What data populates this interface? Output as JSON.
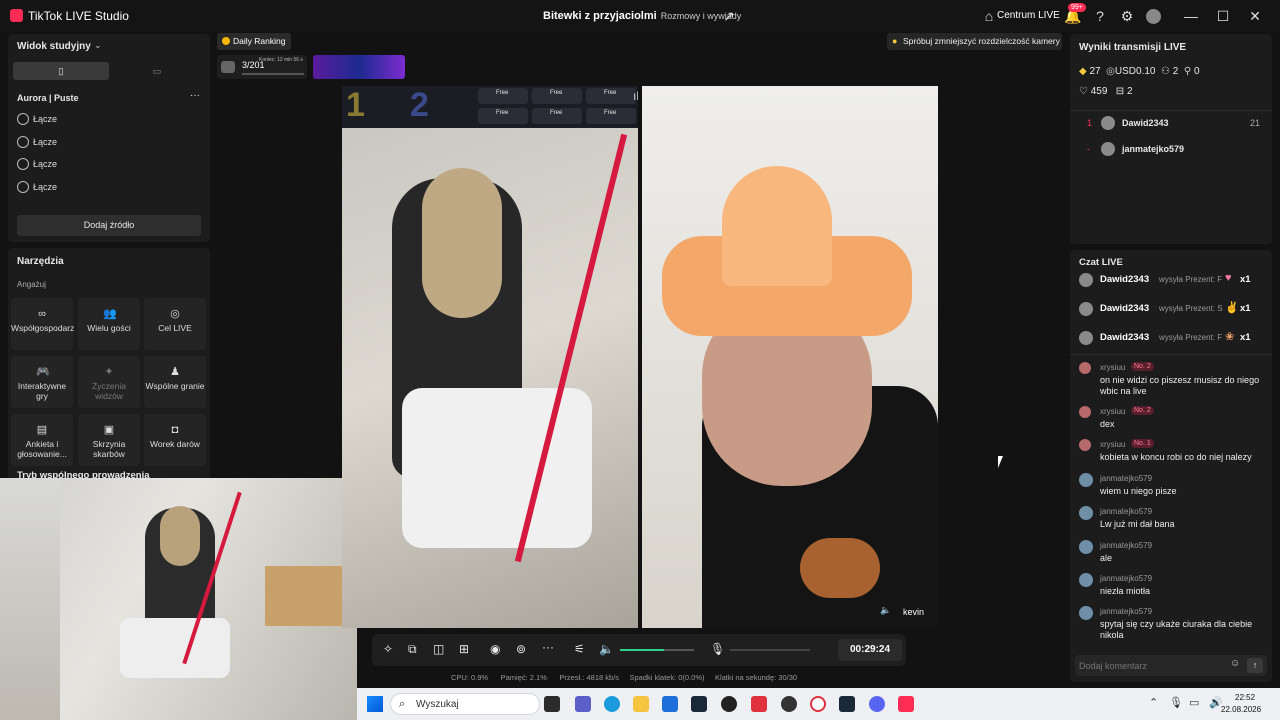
{
  "titlebar": {
    "app_name": "TikTok LIVE Studio",
    "title": "Bitewki z przyjaciolmi",
    "subtitle": "Rozmowy i wywiady",
    "live_center": "Centrum LIVE",
    "notif_badge": "99+"
  },
  "left": {
    "view_label": "Widok studyjny",
    "scene_label": "Aurora | Puste",
    "sources": [
      "Łącze",
      "Łącze",
      "Łącze",
      "Łącze"
    ],
    "add_source": "Dodaj źródło",
    "tools_title": "Narzędzia",
    "engage_label": "Angażuj",
    "tools": [
      "Współgospodarz",
      "Wielu gości",
      "Cel LIVE",
      "Interaktywne gry",
      "Życzenia widzów",
      "Wspólne granie",
      "Ankieta i głosowanie...",
      "Skrzynia skarbów",
      "Worek darów"
    ],
    "co_host_mode": "Tryb wspólnego prowadzenia"
  },
  "top": {
    "daily_ranking": "Daily Ranking",
    "rank": "3/201",
    "rank_sub": "Koniec: 12 min 56 s",
    "hint": "Spróbuj zmniejszyć rozdzielczość kamery"
  },
  "battle": {
    "slot1": "1",
    "slot2": "2",
    "free": "Free",
    "name_tag": "kevin"
  },
  "controls": {
    "timer": "00:29:24",
    "volume": 0.6
  },
  "stats": {
    "cpu": "CPU: 0.9%",
    "mem": "Pamięć: 2.1%",
    "bitrate": "Przesł.: 4818 kb/s",
    "drops": "Spadki klatek: 0(0.0%)",
    "fps": "Klatki na sekundę: 30/30"
  },
  "results": {
    "title": "Wyniki transmisji LIVE",
    "diamonds": "27",
    "usd": "USD0.10",
    "viewers": "2",
    "followers": "0",
    "likes": "459",
    "gifts": "2",
    "ranking": [
      {
        "pos": "1",
        "name": "Dawid2343",
        "score": "21"
      },
      {
        "pos": "-",
        "name": "janmatejko579",
        "score": ""
      }
    ]
  },
  "chat": {
    "title": "Czat LIVE",
    "gifts": [
      {
        "user": "Dawid2343",
        "text": "wysyła Prezent: F",
        "count": "x1"
      },
      {
        "user": "Dawid2343",
        "text": "wysyła Prezent: S",
        "count": "x1"
      },
      {
        "user": "Dawid2343",
        "text": "wysyła Prezent: F",
        "count": "x1"
      }
    ],
    "messages": [
      {
        "user": "xrysiuu",
        "badge": "No. 2",
        "text": "on nie widzi co piszesz musisz do niego wbic na live"
      },
      {
        "user": "xrysiuu",
        "badge": "No. 2",
        "text": "dex"
      },
      {
        "user": "xrysiuu",
        "badge": "No. 1",
        "text": "kobieta w koncu robi co do niej nalezy"
      },
      {
        "user": "janmatejko579",
        "badge": "",
        "text": "wiem u niego pisze"
      },
      {
        "user": "janmatejko579",
        "badge": "",
        "text": "Lw już mi dał bana"
      },
      {
        "user": "janmatejko579",
        "badge": "",
        "text": "ale"
      },
      {
        "user": "janmatejko579",
        "badge": "",
        "text": "niezła miotła"
      },
      {
        "user": "janmatejko579",
        "badge": "",
        "text": "spytaj się czy ukaże ciuraka dla ciebie nikola"
      }
    ],
    "input_placeholder": "Dodaj komentarz"
  },
  "taskbar": {
    "search": "Wyszukaj",
    "time": "22:52",
    "date": "22.08.2026"
  },
  "colors": {
    "accent": "#fe2c55",
    "green": "#2fd28a"
  }
}
